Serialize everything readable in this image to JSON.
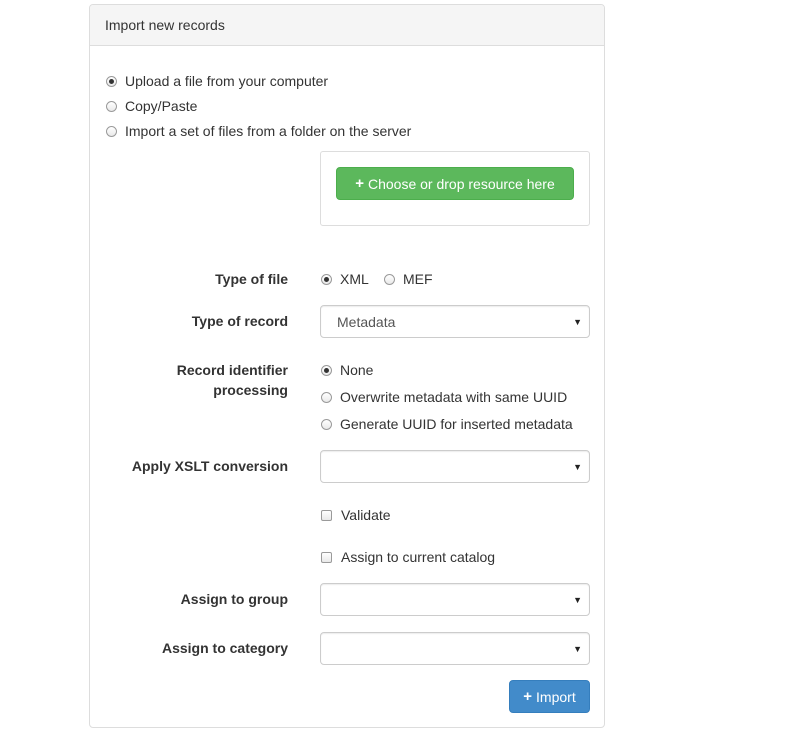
{
  "panel": {
    "title": "Import new records"
  },
  "source_options": [
    {
      "label": "Upload a file from your computer",
      "selected": true
    },
    {
      "label": "Copy/Paste",
      "selected": false
    },
    {
      "label": "Import a set of files from a folder on the server",
      "selected": false
    }
  ],
  "upload": {
    "button_label": "Choose or drop resource here",
    "icon": "plus-icon"
  },
  "type_of_file": {
    "label": "Type of file",
    "options": [
      {
        "label": "XML",
        "selected": true
      },
      {
        "label": "MEF",
        "selected": false
      }
    ]
  },
  "type_of_record": {
    "label": "Type of record",
    "value": "Metadata"
  },
  "record_identifier": {
    "label_line1": "Record identifier",
    "label_line2": "processing",
    "options": [
      {
        "label": "None",
        "selected": true
      },
      {
        "label": "Overwrite metadata with same UUID",
        "selected": false
      },
      {
        "label": "Generate UUID for inserted metadata",
        "selected": false
      }
    ]
  },
  "xslt": {
    "label": "Apply XSLT conversion",
    "value": ""
  },
  "validate": {
    "label": "Validate",
    "checked": false
  },
  "assign_catalog": {
    "label": "Assign to current catalog",
    "checked": false
  },
  "assign_group": {
    "label": "Assign to group",
    "value": ""
  },
  "assign_category": {
    "label": "Assign to category",
    "value": ""
  },
  "import_button": {
    "label": "Import",
    "icon": "plus-icon"
  },
  "colors": {
    "success": "#5cb85c",
    "primary": "#428bca",
    "heading_bg": "#f5f5f5"
  }
}
